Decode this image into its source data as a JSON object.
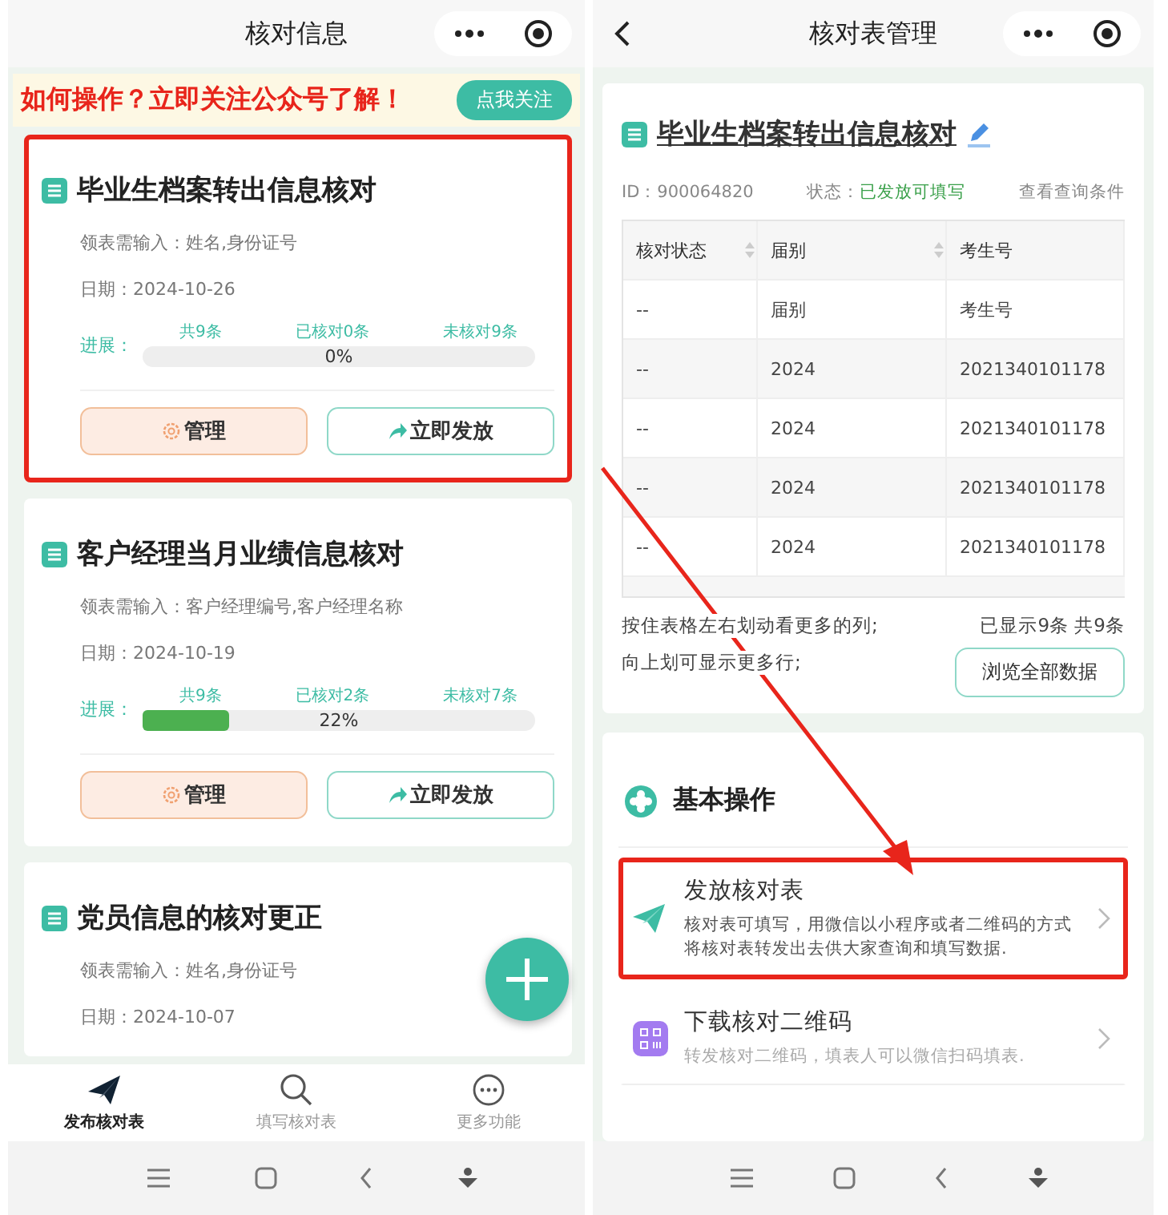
{
  "left_screen": {
    "title": "核对信息",
    "banner": {
      "text": "如何操作？立即关注公众号了解！",
      "button": "点我关注"
    },
    "cards": [
      {
        "title": "毕业生档案转出信息核对",
        "fields": "领表需输入：姓名,身份证号",
        "date": "日期：2024-10-26",
        "progress_label": "进展：",
        "total": "共9条",
        "checked": "已核对0条",
        "unchecked": "未核对9条",
        "level": 0,
        "percent": "0%",
        "buttons": [
          "管理",
          "立即发放"
        ],
        "highlighted": true
      },
      {
        "title": "客户经理当月业绩信息核对",
        "fields": "领表需输入：客户经理编号,客户经理名称",
        "date": "日期：2024-10-19",
        "progress_label": "进展：",
        "total": "共9条",
        "checked": "已核对2条",
        "unchecked": "未核对7条",
        "level": 0.22,
        "percent": "22%",
        "buttons": [
          "管理",
          "立即发放"
        ],
        "highlighted": false
      },
      {
        "title": "党员信息的核对更正",
        "fields": "领表需输入：姓名,身份证号",
        "date": "日期：2024-10-07",
        "highlighted": false
      }
    ],
    "tabs": [
      {
        "label": "发布核对表",
        "selected": true
      },
      {
        "label": "填写核对表",
        "selected": false
      },
      {
        "label": "更多功能",
        "selected": false
      }
    ]
  },
  "right_screen": {
    "title": "核对表管理",
    "record": {
      "title": "毕业生档案转出信息核对",
      "id": "ID：900064820",
      "status_label": "状态：",
      "status": "已发放可填写",
      "query_link": "查看查询条件",
      "table": {
        "columns": [
          "核对状态",
          "届别",
          "考生号"
        ],
        "rows": [
          [
            "--",
            "届别",
            "考生号"
          ],
          [
            "--",
            "2024",
            "2021340101178"
          ],
          [
            "--",
            "2024",
            "2021340101178"
          ],
          [
            "--",
            "2024",
            "2021340101178"
          ],
          [
            "--",
            "2024",
            "2021340101178"
          ]
        ]
      },
      "hint_lines": [
        "按住表格左右划动看更多的列;",
        "向上划可显示更多行;"
      ],
      "count": "已显示9条 共9条",
      "browse_button": "浏览全部数据"
    },
    "operations": {
      "title": "基本操作",
      "items": [
        {
          "title": "发放核对表",
          "description": "核对表可填写，用微信以小程序或者二维码的方式将核对表转发出去供大家查询和填写数据.",
          "highlighted": true
        },
        {
          "title": "下载核对二维码",
          "description": "转发核对二维码，填表人可以微信扫码填表.",
          "highlighted": false
        }
      ]
    }
  }
}
